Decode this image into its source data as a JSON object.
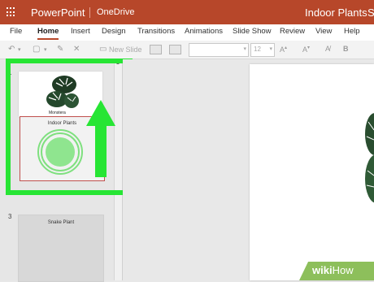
{
  "titlebar": {
    "app_name": "PowerPoint",
    "location": "OneDrive",
    "document_title": "Indoor Plants",
    "user_initial": "S",
    "color": "#b7472a"
  },
  "ribbon": {
    "tabs": [
      "File",
      "Home",
      "Insert",
      "Design",
      "Transitions",
      "Animations",
      "Slide Show",
      "Review",
      "View",
      "Help"
    ],
    "active_tab": "Home"
  },
  "toolbar": {
    "undo_icon": "undo-icon",
    "new_slide_label": "New Slide",
    "font_size": "12"
  },
  "thumbnails": {
    "slide1": {
      "number": "1",
      "caption": "Monstera"
    },
    "slide2": {
      "title": "Indoor Plants"
    },
    "slide3": {
      "number": "3",
      "title": "Snake Plant"
    },
    "highlight_color": "#27e534",
    "selected_border_color": "#c0504d"
  },
  "watermark": {
    "brand": "wiki",
    "brand_suffix": "How"
  }
}
